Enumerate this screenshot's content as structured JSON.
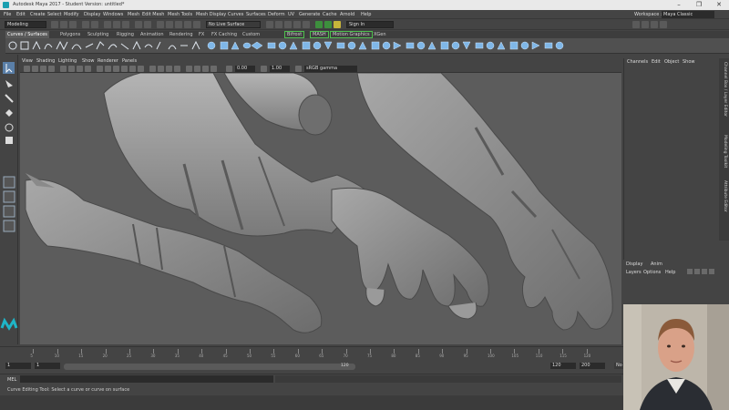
{
  "window": {
    "title": "Autodesk Maya 2017 - Student Version: untitled*",
    "controls": [
      "–",
      "❐",
      "✕"
    ]
  },
  "menubar": {
    "items": [
      "File",
      "Edit",
      "Create",
      "Select",
      "Modify",
      "Display",
      "Windows",
      "Mesh",
      "Edit Mesh",
      "Mesh Tools",
      "Mesh Display",
      "Curves",
      "Surfaces",
      "Deform",
      "UV",
      "Generate",
      "Cache",
      "Arnold",
      "Help"
    ],
    "workspace_label": "Workspace :",
    "workspace_value": "Maya Classic"
  },
  "statusline": {
    "menuset": "Modeling",
    "live_surface": "No Live Surface",
    "sign_in": "Sign In"
  },
  "shelf": {
    "tabs": [
      "Curves / Surfaces",
      "Polygons",
      "Sculpting",
      "Rigging",
      "Animation",
      "Rendering",
      "FX",
      "FX Caching",
      "Custom",
      "Bifrost",
      "MASH",
      "Motion Graphics",
      "XGen"
    ],
    "active_tab": "Curves / Surfaces",
    "highlight_color": "#4fbf4f"
  },
  "panel": {
    "menus": [
      "View",
      "Shading",
      "Lighting",
      "Show",
      "Renderer",
      "Panels"
    ],
    "near": "0.00",
    "scale": "1.00",
    "colorspace": "sRGB gamma"
  },
  "channelbox": {
    "menus": [
      "Channels",
      "Edit",
      "Object",
      "Show"
    ],
    "layer_tabs": [
      "Display",
      "Anim"
    ],
    "layer_menus": [
      "Layers",
      "Options",
      "Help"
    ],
    "side_tabs": [
      "Channel Box / Layer Editor",
      "Modeling Toolkit",
      "Attribute Editor"
    ]
  },
  "timeslider": {
    "ticks": [
      "5",
      "10",
      "15",
      "20",
      "25",
      "30",
      "35",
      "40",
      "45",
      "50",
      "55",
      "60",
      "65",
      "70",
      "75",
      "80",
      "85",
      "90",
      "95",
      "100",
      "105",
      "110",
      "115",
      "120"
    ],
    "current_frame": "1"
  },
  "range": {
    "start": "1",
    "inner_start": "1",
    "bar_label": "120",
    "end": "120",
    "max": "200",
    "anim_layer": "No Anim Layer"
  },
  "cmdline": {
    "mel_label": "MEL"
  },
  "helpline": {
    "text": "Curve Editing Tool: Select a curve or curve on surface"
  },
  "colors": {
    "viewport_bg": "#5c5c5c",
    "sculpt": "#9a9a9a",
    "maya_logo": "#1fb5c7"
  }
}
